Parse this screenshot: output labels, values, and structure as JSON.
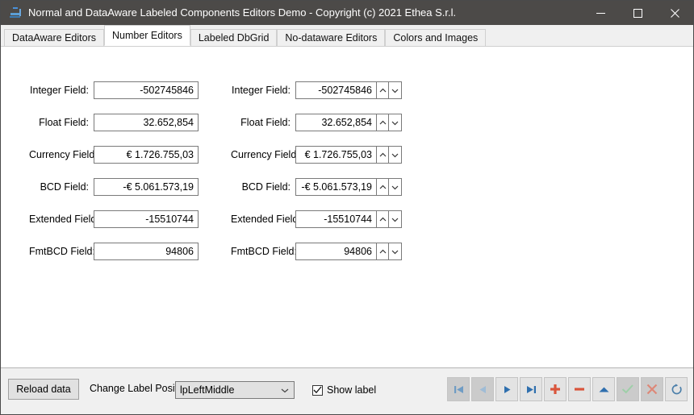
{
  "window": {
    "title": "Normal and DataAware Labeled Components Editors Demo - Copyright (c) 2021 Ethea S.r.l.",
    "icon": "app-icon",
    "controls": {
      "minimize": "minimize-icon",
      "maximize": "maximize-icon",
      "close": "close-icon"
    }
  },
  "tabs": [
    {
      "label": "DataAware Editors",
      "active": false
    },
    {
      "label": "Number Editors",
      "active": true
    },
    {
      "label": "Labeled DbGrid",
      "active": false
    },
    {
      "label": "No-dataware Editors",
      "active": false
    },
    {
      "label": "Colors and Images",
      "active": false
    }
  ],
  "left_column": [
    {
      "label": "Integer Field:",
      "value": "-502745846"
    },
    {
      "label": "Float Field:",
      "value": "32.652,854"
    },
    {
      "label": "Currency Field:",
      "value": "€ 1.726.755,03"
    },
    {
      "label": "BCD Field:",
      "value": "-€ 5.061.573,19"
    },
    {
      "label": "Extended Field:",
      "value": "-15510744"
    },
    {
      "label": "FmtBCD Field:",
      "value": "94806"
    }
  ],
  "right_column": [
    {
      "label": "Integer Field:",
      "value": "-502745846"
    },
    {
      "label": "Float Field:",
      "value": "32.652,854"
    },
    {
      "label": "Currency Field:",
      "value": "€ 1.726.755,03"
    },
    {
      "label": "BCD Field:",
      "value": "-€ 5.061.573,19"
    },
    {
      "label": "Extended Field:",
      "value": "-15510744"
    },
    {
      "label": "FmtBCD Field:",
      "value": "94806"
    }
  ],
  "spinner": {
    "up_icon": "chevron-up-icon",
    "down_icon": "chevron-down-icon"
  },
  "bottom": {
    "reload_label": "Reload data",
    "label_position_caption": "Change Label Position:",
    "label_position_value": "lpLeftMiddle",
    "combo_arrow_icon": "chevron-down-icon",
    "show_label_text": "Show label",
    "show_label_checked": true
  },
  "navigator": [
    {
      "name": "first-record-button",
      "icon": "skip-to-start-icon",
      "enabled": false,
      "color": "#6f9cc4"
    },
    {
      "name": "prior-record-button",
      "icon": "play-back-icon",
      "enabled": false,
      "color": "#6f9cc4"
    },
    {
      "name": "next-record-button",
      "icon": "play-forward-icon",
      "enabled": true,
      "color": "#2f6fae"
    },
    {
      "name": "last-record-button",
      "icon": "skip-to-end-icon",
      "enabled": true,
      "color": "#2f6fae"
    },
    {
      "name": "insert-record-button",
      "icon": "plus-icon",
      "enabled": true,
      "color": "#d9553c"
    },
    {
      "name": "delete-record-button",
      "icon": "minus-icon",
      "enabled": true,
      "color": "#d9553c"
    },
    {
      "name": "edit-record-button",
      "icon": "triangle-up-icon",
      "enabled": true,
      "color": "#2f6fae"
    },
    {
      "name": "post-record-button",
      "icon": "check-icon",
      "enabled": false,
      "color": "#9ecfa8"
    },
    {
      "name": "cancel-record-button",
      "icon": "cross-icon",
      "enabled": false,
      "color": "#dd8878"
    },
    {
      "name": "refresh-record-button",
      "icon": "refresh-icon",
      "enabled": true,
      "color": "#4b7faa"
    }
  ],
  "colors": {
    "titlebar": "#4c4a48",
    "panel": "#f0f0f0",
    "page": "#ffffff",
    "accent_blue": "#2f6fae",
    "accent_red": "#d9553c"
  }
}
